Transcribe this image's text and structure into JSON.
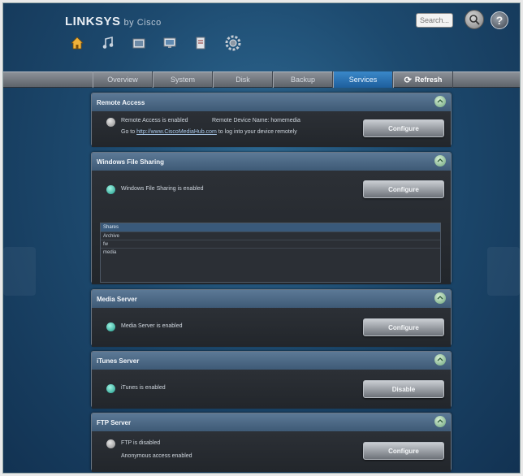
{
  "brand": {
    "name": "LINKSYS",
    "by": "by Cisco"
  },
  "header_icons": [
    "home-icon",
    "music-icon",
    "photo-icon",
    "video-icon",
    "document-icon",
    "gear-icon"
  ],
  "search": {
    "placeholder": "Search..."
  },
  "help_label": "?",
  "tabs": [
    {
      "label": "Overview"
    },
    {
      "label": "System"
    },
    {
      "label": "Disk"
    },
    {
      "label": "Backup"
    },
    {
      "label": "Services",
      "active": true
    },
    {
      "label": "Refresh"
    }
  ],
  "remote": {
    "title": "Remote Access",
    "status": "Remote Access is enabled",
    "device_name": "Remote Device Name: homemedia",
    "link_prefix": "Go to",
    "link": "http://www.CiscoMediaHub.com",
    "link_suffix": "to log into your device remotely",
    "button": "Configure"
  },
  "windows_share": {
    "title": "Windows File Sharing",
    "status": "Windows File Sharing is enabled",
    "button": "Configure",
    "shares_header": "Shares",
    "shares": [
      "Archive",
      "fw",
      "media"
    ]
  },
  "media_server": {
    "title": "Media Server",
    "status": "Media Server is enabled",
    "button": "Configure"
  },
  "itunes_server": {
    "title": "iTunes Server",
    "status": "iTunes is enabled",
    "button": "Disable"
  },
  "ftp_server": {
    "title": "FTP Server",
    "status": "FTP is disabled",
    "anonymous": "Anonymous access enabled",
    "button": "Configure"
  },
  "colors": {
    "background": "#1d4a6f",
    "active_tab": "#2a74b4",
    "panel_header": "#4d6a88",
    "status_on": "#1d9a8a"
  }
}
